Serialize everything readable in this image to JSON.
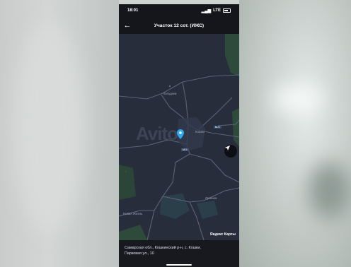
{
  "status_bar": {
    "time": "18:01",
    "network": "LTE"
  },
  "app_bar": {
    "title": "Участок 12 сот. (ИЖС)",
    "back_icon": "arrow-left-icon"
  },
  "map": {
    "labels": {
      "village_1": "Полудник",
      "village_2": "Кошки",
      "village_3": "Новая Жизнь",
      "village_4": "Лукинка"
    },
    "road_badges": {
      "badge_1": "М-5",
      "badge_2": "М-5"
    },
    "watermark": "Avito",
    "attribution": "Яндекс Карты",
    "marker_color": "#2ea7f2",
    "locate_icon": "navigation-arrow-icon"
  },
  "address": {
    "line1": "Самарская обл., Кошкинский р-н, с. Кошки,",
    "line2": "Парковая ул., 10"
  }
}
